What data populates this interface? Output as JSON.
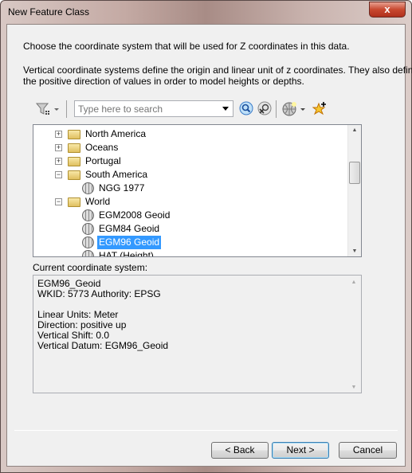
{
  "window": {
    "title": "New Feature Class",
    "close_label": "x"
  },
  "intro": {
    "line1": "Choose the coordinate system that will be used for Z coordinates in this data.",
    "line2": "Vertical coordinate systems define the origin and linear unit of z coordinates. They also define",
    "line3": "the positive direction of values in order to model heights or depths."
  },
  "toolbar": {
    "search_placeholder": "Type here to search",
    "icons": [
      "filter-icon",
      "search-icon",
      "clear-search-icon",
      "globe-add-icon",
      "favorite-add-icon"
    ]
  },
  "tree": {
    "items": [
      {
        "label": "North America",
        "type": "folder",
        "expanded": false,
        "level": 0
      },
      {
        "label": "Oceans",
        "type": "folder",
        "expanded": false,
        "level": 0
      },
      {
        "label": "Portugal",
        "type": "folder",
        "expanded": false,
        "level": 0
      },
      {
        "label": "South America",
        "type": "folder",
        "expanded": true,
        "level": 0
      },
      {
        "label": "NGG 1977",
        "type": "crs",
        "level": 1
      },
      {
        "label": "World",
        "type": "folder",
        "expanded": true,
        "level": 0
      },
      {
        "label": "EGM2008 Geoid",
        "type": "crs",
        "level": 1
      },
      {
        "label": "EGM84 Geoid",
        "type": "crs",
        "level": 1
      },
      {
        "label": "EGM96 Geoid",
        "type": "crs",
        "level": 1,
        "selected": true
      },
      {
        "label": "HAT (Height)",
        "type": "crs",
        "level": 1
      }
    ]
  },
  "current": {
    "label": "Current coordinate system:",
    "lines": [
      "EGM96_Geoid",
      "WKID: 5773 Authority: EPSG",
      "",
      "Linear Units: Meter",
      "Direction: positive up",
      "Vertical Shift: 0.0",
      "Vertical Datum: EGM96_Geoid"
    ]
  },
  "buttons": {
    "back": "< Back",
    "next": "Next >",
    "cancel": "Cancel"
  },
  "colors": {
    "selection": "#3399ff"
  }
}
